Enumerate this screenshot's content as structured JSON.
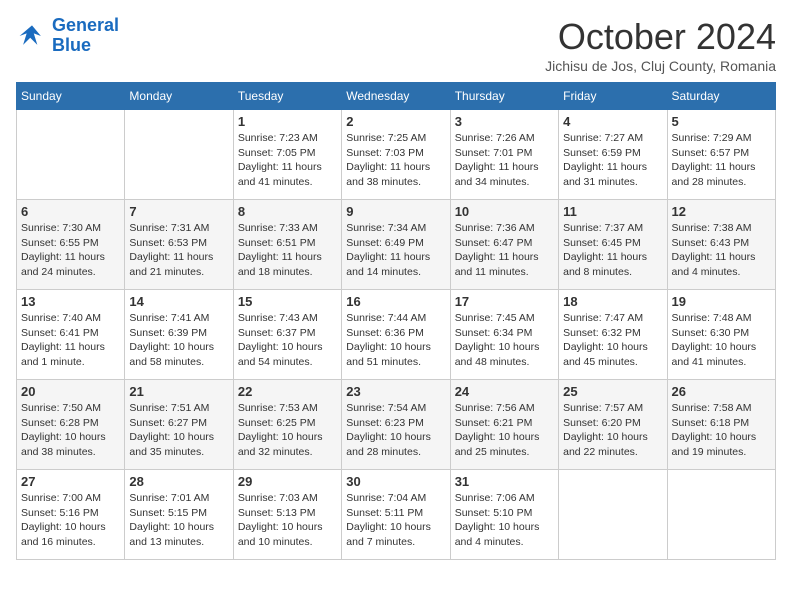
{
  "header": {
    "logo_line1": "General",
    "logo_line2": "Blue",
    "month": "October 2024",
    "location": "Jichisu de Jos, Cluj County, Romania"
  },
  "days_of_week": [
    "Sunday",
    "Monday",
    "Tuesday",
    "Wednesday",
    "Thursday",
    "Friday",
    "Saturday"
  ],
  "weeks": [
    [
      null,
      null,
      {
        "day": 1,
        "sunrise": "7:23 AM",
        "sunset": "7:05 PM",
        "daylight": "11 hours and 41 minutes."
      },
      {
        "day": 2,
        "sunrise": "7:25 AM",
        "sunset": "7:03 PM",
        "daylight": "11 hours and 38 minutes."
      },
      {
        "day": 3,
        "sunrise": "7:26 AM",
        "sunset": "7:01 PM",
        "daylight": "11 hours and 34 minutes."
      },
      {
        "day": 4,
        "sunrise": "7:27 AM",
        "sunset": "6:59 PM",
        "daylight": "11 hours and 31 minutes."
      },
      {
        "day": 5,
        "sunrise": "7:29 AM",
        "sunset": "6:57 PM",
        "daylight": "11 hours and 28 minutes."
      }
    ],
    [
      {
        "day": 6,
        "sunrise": "7:30 AM",
        "sunset": "6:55 PM",
        "daylight": "11 hours and 24 minutes."
      },
      {
        "day": 7,
        "sunrise": "7:31 AM",
        "sunset": "6:53 PM",
        "daylight": "11 hours and 21 minutes."
      },
      {
        "day": 8,
        "sunrise": "7:33 AM",
        "sunset": "6:51 PM",
        "daylight": "11 hours and 18 minutes."
      },
      {
        "day": 9,
        "sunrise": "7:34 AM",
        "sunset": "6:49 PM",
        "daylight": "11 hours and 14 minutes."
      },
      {
        "day": 10,
        "sunrise": "7:36 AM",
        "sunset": "6:47 PM",
        "daylight": "11 hours and 11 minutes."
      },
      {
        "day": 11,
        "sunrise": "7:37 AM",
        "sunset": "6:45 PM",
        "daylight": "11 hours and 8 minutes."
      },
      {
        "day": 12,
        "sunrise": "7:38 AM",
        "sunset": "6:43 PM",
        "daylight": "11 hours and 4 minutes."
      }
    ],
    [
      {
        "day": 13,
        "sunrise": "7:40 AM",
        "sunset": "6:41 PM",
        "daylight": "11 hours and 1 minute."
      },
      {
        "day": 14,
        "sunrise": "7:41 AM",
        "sunset": "6:39 PM",
        "daylight": "10 hours and 58 minutes."
      },
      {
        "day": 15,
        "sunrise": "7:43 AM",
        "sunset": "6:37 PM",
        "daylight": "10 hours and 54 minutes."
      },
      {
        "day": 16,
        "sunrise": "7:44 AM",
        "sunset": "6:36 PM",
        "daylight": "10 hours and 51 minutes."
      },
      {
        "day": 17,
        "sunrise": "7:45 AM",
        "sunset": "6:34 PM",
        "daylight": "10 hours and 48 minutes."
      },
      {
        "day": 18,
        "sunrise": "7:47 AM",
        "sunset": "6:32 PM",
        "daylight": "10 hours and 45 minutes."
      },
      {
        "day": 19,
        "sunrise": "7:48 AM",
        "sunset": "6:30 PM",
        "daylight": "10 hours and 41 minutes."
      }
    ],
    [
      {
        "day": 20,
        "sunrise": "7:50 AM",
        "sunset": "6:28 PM",
        "daylight": "10 hours and 38 minutes."
      },
      {
        "day": 21,
        "sunrise": "7:51 AM",
        "sunset": "6:27 PM",
        "daylight": "10 hours and 35 minutes."
      },
      {
        "day": 22,
        "sunrise": "7:53 AM",
        "sunset": "6:25 PM",
        "daylight": "10 hours and 32 minutes."
      },
      {
        "day": 23,
        "sunrise": "7:54 AM",
        "sunset": "6:23 PM",
        "daylight": "10 hours and 28 minutes."
      },
      {
        "day": 24,
        "sunrise": "7:56 AM",
        "sunset": "6:21 PM",
        "daylight": "10 hours and 25 minutes."
      },
      {
        "day": 25,
        "sunrise": "7:57 AM",
        "sunset": "6:20 PM",
        "daylight": "10 hours and 22 minutes."
      },
      {
        "day": 26,
        "sunrise": "7:58 AM",
        "sunset": "6:18 PM",
        "daylight": "10 hours and 19 minutes."
      }
    ],
    [
      {
        "day": 27,
        "sunrise": "7:00 AM",
        "sunset": "5:16 PM",
        "daylight": "10 hours and 16 minutes."
      },
      {
        "day": 28,
        "sunrise": "7:01 AM",
        "sunset": "5:15 PM",
        "daylight": "10 hours and 13 minutes."
      },
      {
        "day": 29,
        "sunrise": "7:03 AM",
        "sunset": "5:13 PM",
        "daylight": "10 hours and 10 minutes."
      },
      {
        "day": 30,
        "sunrise": "7:04 AM",
        "sunset": "5:11 PM",
        "daylight": "10 hours and 7 minutes."
      },
      {
        "day": 31,
        "sunrise": "7:06 AM",
        "sunset": "5:10 PM",
        "daylight": "10 hours and 4 minutes."
      },
      null,
      null
    ]
  ]
}
